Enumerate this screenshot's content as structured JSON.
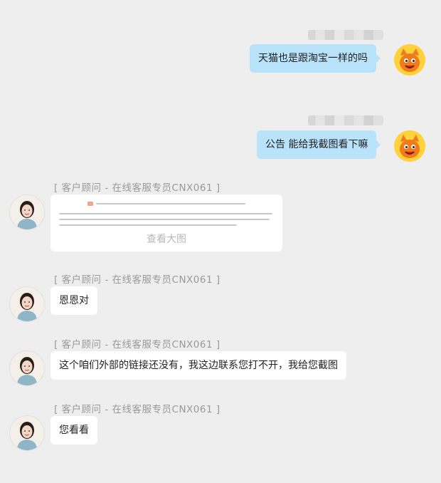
{
  "messages": {
    "m1": {
      "text": "天猫也是跟淘宝一样的吗"
    },
    "m2": {
      "text": "公告 能给我截图看下嘛"
    },
    "m3": {
      "sender": "[ 客户顾问 - 在线客服专员CNX061 ]",
      "image_caption": "查看大图"
    },
    "m4": {
      "sender": "[ 客户顾问 - 在线客服专员CNX061 ]",
      "text": "恩恩对"
    },
    "m5": {
      "sender": "[ 客户顾问 - 在线客服专员CNX061 ]",
      "text": "这个咱们外部的链接还没有，我这边联系您打不开，我给您截图"
    },
    "m6": {
      "sender": "[ 客户顾问 - 在线客服专员CNX061 ]",
      "text": "您看看"
    }
  },
  "colors": {
    "background": "#eeeeee",
    "user_bubble": "#b9e3fb",
    "agent_bubble": "#ffffff",
    "sender_text": "#999999"
  },
  "icons": {
    "user_avatar": "tmall-mascot-icon",
    "agent_avatar": "agent-photo-avatar"
  }
}
